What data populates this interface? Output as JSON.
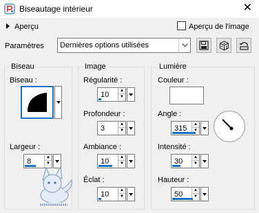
{
  "window": {
    "title": "Biseautage intérieur",
    "close_glyph": "✕",
    "app_icon": "paintshop-icon"
  },
  "preview": {
    "toggle_label": "Aperçu",
    "image_preview_label": "Aperçu de l'image",
    "image_preview_checked": false
  },
  "params": {
    "label": "Paramètres",
    "preset_value": "Dernières options utilisées",
    "buttons": [
      "save-preset-icon",
      "randomize-dice-icon",
      "reset-icon"
    ]
  },
  "bevel": {
    "group_title": "Biseau",
    "bevel_label": "Biseau :",
    "width_label": "Largeur :",
    "width_value": "8"
  },
  "image": {
    "group_title": "Image",
    "smoothness_label": "Régularité :",
    "smoothness_value": "10",
    "depth_label": "Profondeur :",
    "depth_value": "3",
    "ambience_label": "Ambiance :",
    "ambience_value": "10",
    "shininess_label": "Éclat :",
    "shininess_value": "10"
  },
  "light": {
    "group_title": "Lumière",
    "color_label": "Couleur :",
    "color_value": "#ffffff",
    "angle_label": "Angle :",
    "angle_value": "315",
    "intensity_label": "Intensité :",
    "intensity_value": "30",
    "elevation_label": "Hauteur :",
    "elevation_value": "50"
  },
  "colors": {
    "accent": "#1a73c8",
    "dialog_bg": "#f0f0f0"
  }
}
